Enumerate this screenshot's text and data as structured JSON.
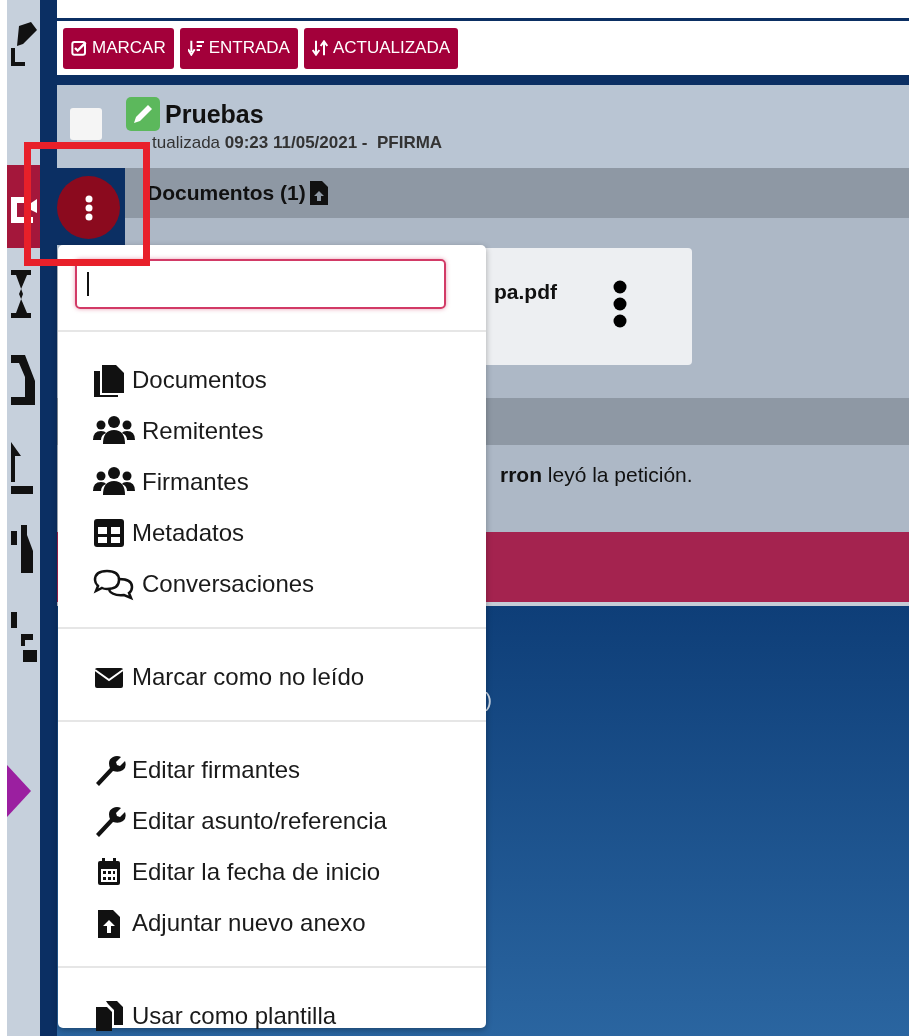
{
  "toolbar": {
    "buttons": [
      {
        "label": "MARCAR",
        "kind": "check"
      },
      {
        "label": "ENTRADA",
        "kind": "sort-down"
      },
      {
        "label": "ACTUALIZADA",
        "kind": "sort-both"
      }
    ]
  },
  "request": {
    "title": "Pruebas",
    "checked": false,
    "meta": "tualizada **09:23 11/05/2021 -  PFIRMA**"
  },
  "documents": {
    "header": "Documentos (1)",
    "file": "pa.pdf"
  },
  "history": {
    "text": "**rron** leyó la petición."
  },
  "fragment": ")",
  "menu": {
    "groups": [
      [
        {
          "label": "Documentos",
          "kind": "files"
        },
        {
          "label": "Remitentes",
          "kind": "users"
        },
        {
          "label": "Firmantes",
          "kind": "users"
        },
        {
          "label": "Metadatos",
          "kind": "table"
        },
        {
          "label": "Conversaciones",
          "kind": "comments"
        }
      ],
      [
        {
          "label": "Marcar como no leído",
          "kind": "envelope"
        }
      ],
      [
        {
          "label": "Editar firmantes",
          "kind": "wrench"
        },
        {
          "label": "Editar asunto/referencia",
          "kind": "wrench"
        },
        {
          "label": "Editar la fecha de inicio",
          "kind": "calendar"
        },
        {
          "label": "Adjuntar nuevo anexo",
          "kind": "file-upload"
        }
      ],
      [
        {
          "label": "Usar como plantilla",
          "kind": "copy"
        }
      ]
    ]
  }
}
